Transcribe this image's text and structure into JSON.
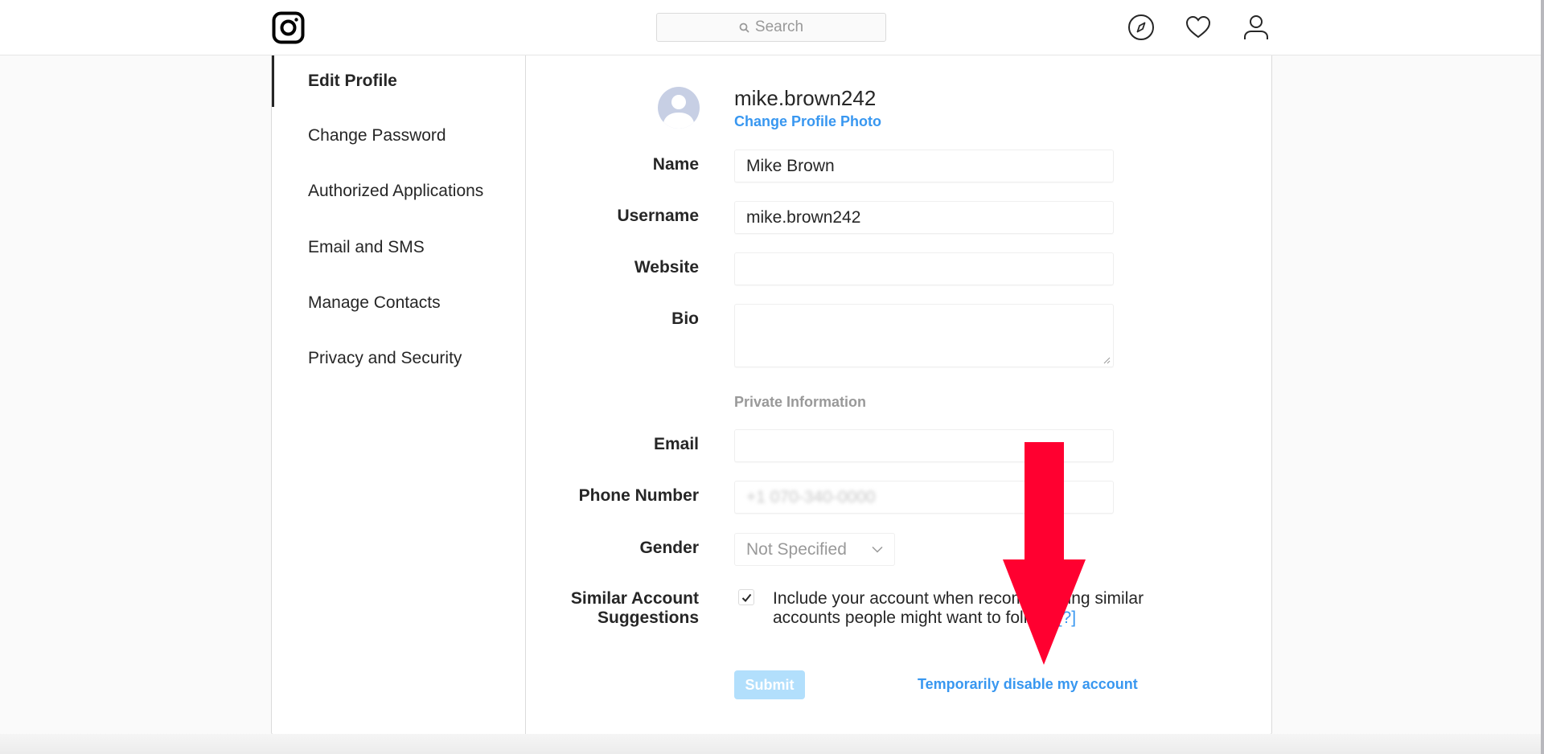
{
  "header": {
    "logo": "instagram-logo-icon",
    "search": {
      "placeholder": "Search",
      "icon": "search-icon"
    },
    "nav_icons": [
      "compass-icon",
      "heart-icon",
      "user-icon"
    ]
  },
  "sidebar": {
    "items": [
      {
        "label": "Edit Profile",
        "active": true
      },
      {
        "label": "Change Password"
      },
      {
        "label": "Authorized Applications"
      },
      {
        "label": "Email and SMS"
      },
      {
        "label": "Manage Contacts"
      },
      {
        "label": "Privacy and Security"
      }
    ]
  },
  "profile": {
    "username": "mike.brown242",
    "change_photo_label": "Change Profile Photo"
  },
  "form": {
    "name": {
      "label": "Name",
      "value": "Mike Brown"
    },
    "username": {
      "label": "Username",
      "value": "mike.brown242"
    },
    "website": {
      "label": "Website",
      "value": ""
    },
    "bio": {
      "label": "Bio",
      "value": ""
    },
    "private_title": "Private Information",
    "email": {
      "label": "Email",
      "value": ""
    },
    "phone": {
      "label": "Phone Number",
      "value": "+1 070-340-0000 (blurred)"
    },
    "gender": {
      "label": "Gender",
      "value": "Not Specified"
    },
    "similar": {
      "label_line1": "Similar Account",
      "label_line2": "Suggestions",
      "checked": true,
      "text": "Include your account when recommending similar accounts people might want to follow.",
      "help": "[?]"
    },
    "submit_label": "Submit",
    "disable_label": "Temporarily disable my account"
  },
  "annotation": {
    "type": "arrow-down",
    "color": "#FF0030"
  },
  "colors": {
    "link": "#3897f0",
    "submit_disabled": "#b2dffc",
    "border": "#dbdbdb"
  }
}
